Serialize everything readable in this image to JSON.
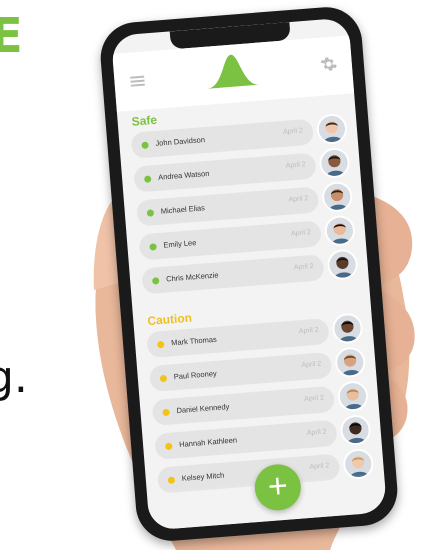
{
  "edge_text": {
    "top": "E",
    "bottom": "g."
  },
  "header": {
    "menu_icon": "hamburger-menu-icon",
    "logo_icon": "green-peak-logo",
    "settings_icon": "gear-icon"
  },
  "sections": {
    "safe": {
      "title": "Safe",
      "color": "#7cc242",
      "items": [
        {
          "name": "John Davidson",
          "date": "April 2"
        },
        {
          "name": "Andrea Watson",
          "date": "April 2"
        },
        {
          "name": "Michael Elias",
          "date": "April 2"
        },
        {
          "name": "Emily Lee",
          "date": "April 2"
        },
        {
          "name": "Chris McKenzie",
          "date": "April 2"
        }
      ]
    },
    "caution": {
      "title": "Caution",
      "color": "#f2c318",
      "items": [
        {
          "name": "Mark Thomas",
          "date": "April 2"
        },
        {
          "name": "Paul Rooney",
          "date": "April 2"
        },
        {
          "name": "Daniel Kennedy",
          "date": "April 2"
        },
        {
          "name": "Hannah Kathleen",
          "date": "April 2"
        },
        {
          "name": "Kelsey Mitch",
          "date": "April 2"
        }
      ]
    }
  },
  "fab": {
    "label": "+",
    "color": "#7cc242"
  }
}
